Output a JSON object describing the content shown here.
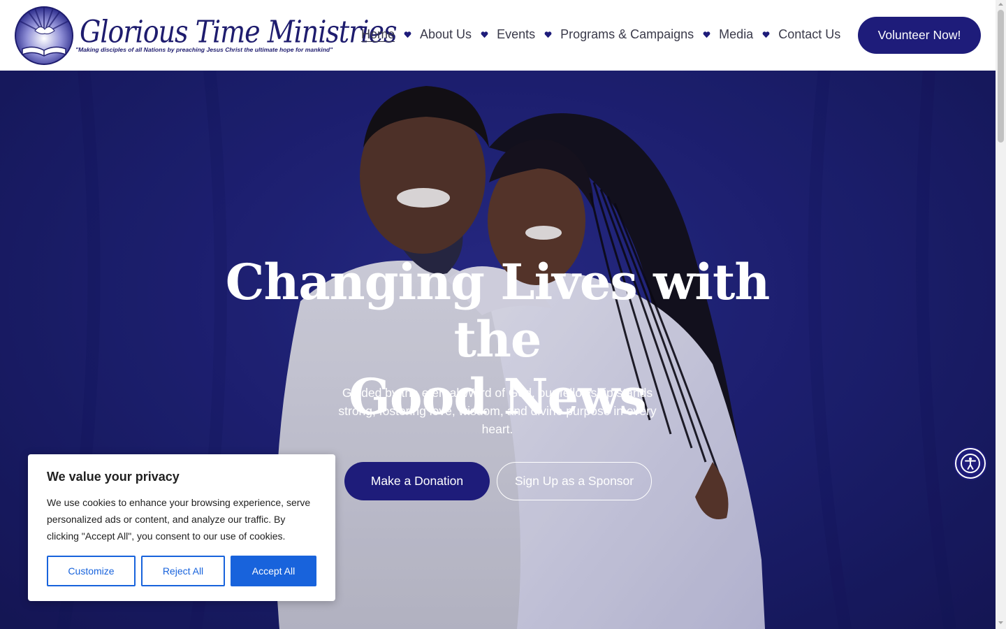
{
  "logo": {
    "title": "Glorious Time Ministries",
    "tagline": "\"Making disciples of all Nations by preaching Jesus Christ the ultimate hope for mankind\""
  },
  "nav": {
    "items": [
      {
        "label": "Home",
        "active": true
      },
      {
        "label": "About Us",
        "active": false
      },
      {
        "label": "Events",
        "active": false
      },
      {
        "label": "Programs & Campaigns",
        "active": false
      },
      {
        "label": "Media",
        "active": false
      },
      {
        "label": "Contact Us",
        "active": false
      }
    ],
    "separator_icon": "heart-icon"
  },
  "header": {
    "volunteer_label": "Volunteer Now!"
  },
  "hero": {
    "title_line1": "Changing Lives with the",
    "title_line2": "Good News",
    "subtitle": "Guided by the eternal Word of God, our fellowship stands strong, fostering love, wisdom, and divine purpose in every heart.",
    "donate_label": "Make a Donation",
    "sponsor_label": "Sign Up as a Sponsor"
  },
  "cookie": {
    "title": "We value your privacy",
    "text": "We use cookies to enhance your browsing experience, serve personalized ads or content, and analyze our traffic. By clicking \"Accept All\", you consent to our use of cookies.",
    "customize_label": "Customize",
    "reject_label": "Reject All",
    "accept_label": "Accept All"
  },
  "colors": {
    "brand_navy": "#1e1c7a",
    "hero_blue": "#1f2278",
    "cookie_blue": "#1863dc",
    "nav_text": "#3a3a4a"
  },
  "icons": {
    "accessibility": "accessibility-icon",
    "logo_emblem": "dove-bible-emblem-icon"
  }
}
